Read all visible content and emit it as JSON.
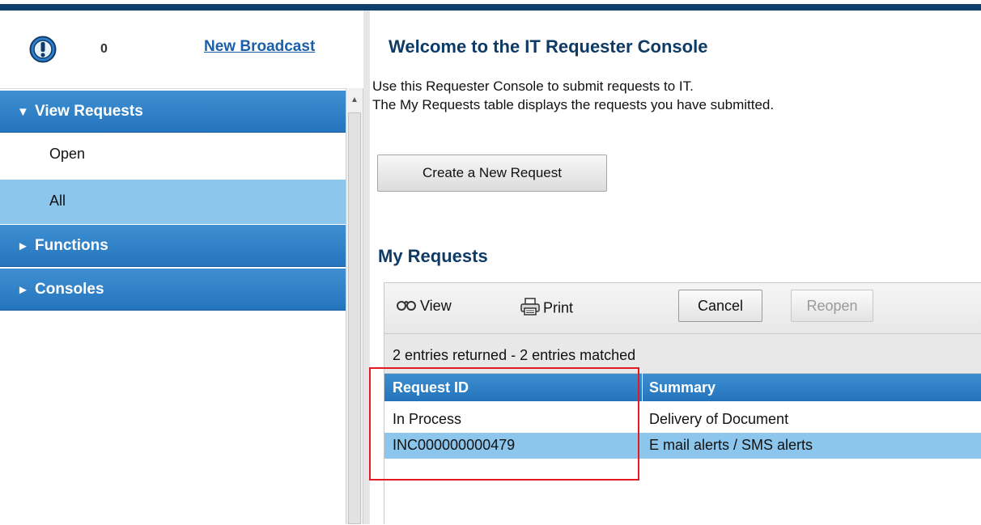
{
  "header": {
    "alert_count": "0",
    "new_broadcast_label": "New Broadcast"
  },
  "nav": {
    "groups": [
      {
        "label": "View Requests",
        "expanded": true,
        "caret": "▼"
      },
      {
        "label": "Functions",
        "expanded": false,
        "caret": "►"
      },
      {
        "label": "Consoles",
        "expanded": false,
        "caret": "►"
      }
    ],
    "items": [
      {
        "label": "Open",
        "selected": false
      },
      {
        "label": "All",
        "selected": true
      }
    ]
  },
  "main": {
    "title": "Welcome to the IT Requester Console",
    "intro_line1": "Use this Requester Console to submit requests to IT.",
    "intro_line2": "The My Requests table displays the requests you have submitted.",
    "create_button_label": "Create a New Request",
    "section_title": "My Requests"
  },
  "toolbar": {
    "view_label": "View",
    "print_label": "Print",
    "cancel_label": "Cancel",
    "reopen_label": "Reopen"
  },
  "table": {
    "summary": "2 entries returned - 2 entries matched",
    "columns": [
      "Request ID",
      "Summary"
    ],
    "rows": [
      [
        "In Process",
        "Delivery of Document"
      ],
      [
        "INC000000000479",
        "E mail alerts / SMS alerts"
      ]
    ]
  },
  "colors": {
    "accent_dark": "#0e3a66",
    "nav_blue": "#2475bd",
    "selection_blue": "#8dc6ec",
    "annotation_red": "#e31b23"
  }
}
